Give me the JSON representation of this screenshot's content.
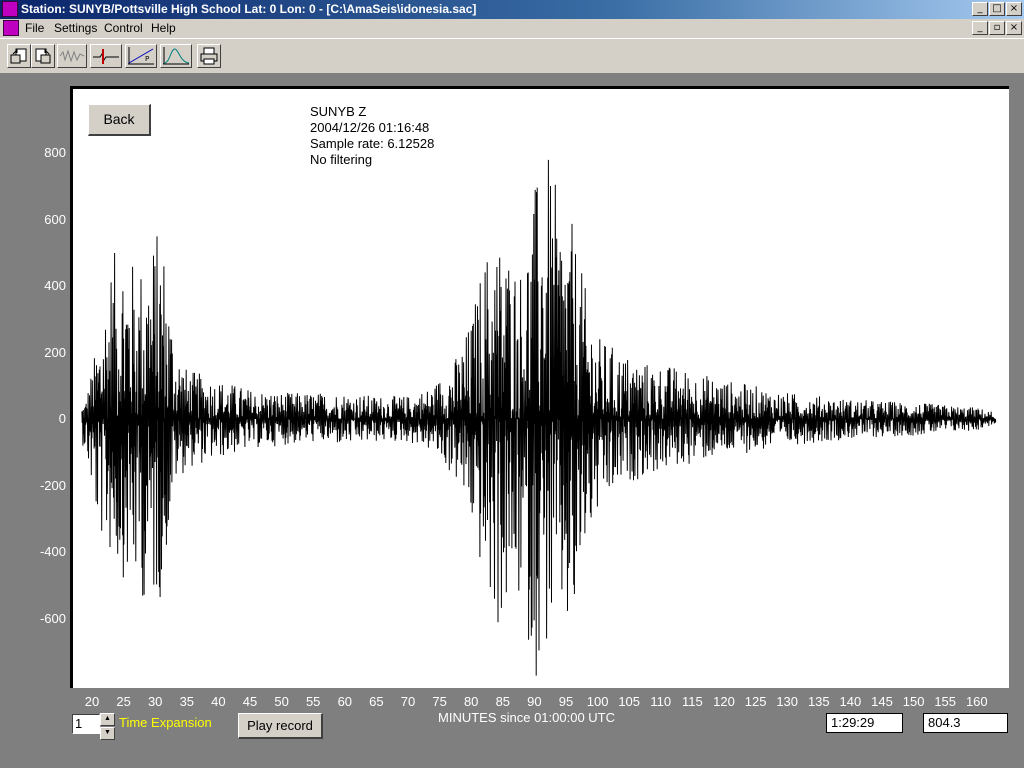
{
  "window": {
    "title": "Station: SUNYB/Pottsville High School Lat: 0 Lon: 0 - [C:\\AmaSeis\\idonesia.sac]",
    "caption_buttons": [
      "_",
      "□",
      "×"
    ]
  },
  "menu": {
    "items": [
      "File",
      "Settings",
      "Control",
      "Help"
    ],
    "mdi_buttons": [
      "_",
      "▫",
      "×"
    ]
  },
  "toolbar": {
    "buttons": [
      "open-file-icon",
      "save-file-icon",
      "waveform-icon",
      "pick-marker-icon",
      "travel-time-icon",
      "spectrum-icon",
      "print-icon"
    ]
  },
  "plot": {
    "back_label": "Back",
    "station_line": "SUNYB  Z",
    "datetime_line": "2004/12/26 01:16:48",
    "sample_rate_line": "Sample rate: 6.12528",
    "filter_line": "No filtering"
  },
  "chart_data": {
    "type": "line",
    "xlabel": "MINUTES since 01:00:00 UTC",
    "ylabel": "",
    "xlim": [
      17,
      164
    ],
    "ylim": [
      -800,
      1000
    ],
    "x_ticks": [
      20,
      25,
      30,
      35,
      40,
      45,
      50,
      55,
      60,
      65,
      70,
      75,
      80,
      85,
      90,
      95,
      100,
      105,
      110,
      115,
      120,
      125,
      130,
      135,
      140,
      145,
      150,
      155,
      160
    ],
    "y_ticks": [
      800,
      600,
      400,
      200,
      0,
      -200,
      -400,
      -600
    ],
    "series": [
      {
        "color": "#000000",
        "envelope": {
          "x": [
            17,
            19,
            21,
            23,
            25,
            27,
            29,
            31,
            33,
            35,
            40,
            45,
            50,
            55,
            60,
            65,
            70,
            74,
            76,
            78,
            80,
            82,
            84,
            86,
            88,
            90,
            92,
            94,
            96,
            98,
            100,
            104,
            108,
            112,
            116,
            120,
            125,
            130,
            140,
            150,
            160,
            163
          ],
          "max": [
            10,
            60,
            250,
            480,
            560,
            450,
            520,
            600,
            250,
            150,
            120,
            90,
            80,
            80,
            80,
            70,
            70,
            100,
            150,
            200,
            300,
            500,
            560,
            520,
            460,
            700,
            810,
            650,
            590,
            400,
            250,
            200,
            170,
            160,
            140,
            120,
            100,
            80,
            60,
            50,
            35,
            20
          ],
          "min": [
            -10,
            -100,
            -350,
            -420,
            -480,
            -520,
            -570,
            -540,
            -200,
            -150,
            -120,
            -90,
            -80,
            -70,
            -80,
            -70,
            -70,
            -100,
            -150,
            -200,
            -320,
            -500,
            -650,
            -580,
            -560,
            -790,
            -700,
            -600,
            -720,
            -400,
            -300,
            -200,
            -170,
            -150,
            -130,
            -110,
            -100,
            -80,
            -60,
            -50,
            -35,
            -15
          ]
        }
      }
    ]
  },
  "bottom": {
    "expansion_value": "1",
    "spin_up": "▲",
    "spin_down": "▼",
    "expansion_label": "Time Expansion",
    "play_label": "Play record",
    "time_readout": "1:29:29",
    "amplitude_readout": "804.3"
  }
}
